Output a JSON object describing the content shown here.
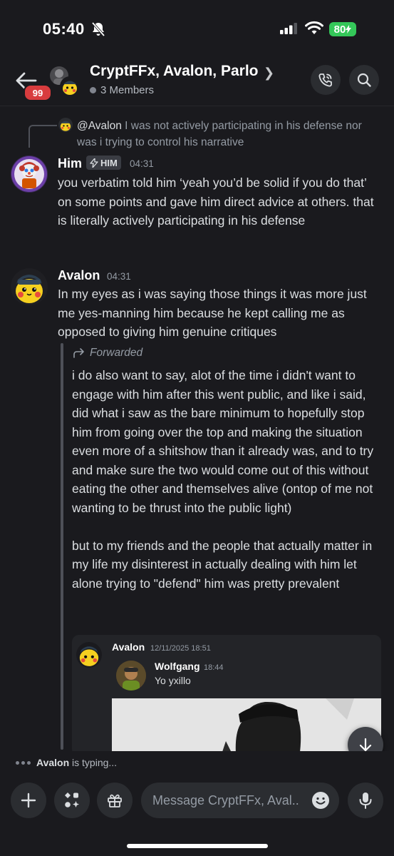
{
  "status_bar": {
    "time": "05:40",
    "battery": "80"
  },
  "header": {
    "unread_badge": "99",
    "title": "CryptFFx, Avalon, Parlo",
    "members": "3 Members",
    "icons": [
      "back-arrow-icon",
      "phone-call-icon",
      "search-icon"
    ]
  },
  "reply": {
    "mention": "@Avalon",
    "text": "I was not actively participating in his defense nor was i trying to control his narrative"
  },
  "messages": [
    {
      "author": "Him",
      "tag": "HIM",
      "time": "04:31",
      "text": "you verbatim told him ‘yeah you’d be solid if you do that’ on some points and gave him direct advice at others. that is literally actively participating in his defense"
    },
    {
      "author": "Avalon",
      "time": "04:31",
      "text": "In my eyes as i was saying those things it was more just me yes-manning him because he kept calling me as opposed to giving him genuine critiques",
      "forwarded": {
        "label": "Forwarded",
        "paragraphs": [
          "i do also want to say, alot of the time i didn't want to engage with him after this went public, and like i said, did what i saw as the bare minimum to hopefully stop him from going over the top and making the situation even more of a shitshow than it already was, and to try and make sure the two would come out of this without eating the other and themselves alive (ontop of me not wanting to be thrust into the public light)",
          "but to my friends and the people that actually matter in my life my disinterest in actually dealing with him let alone trying to \"defend\" him was pretty prevalent"
        ],
        "embed": {
          "author": "Avalon",
          "time": "12/11/2025 18:51",
          "inner_author": "Wolfgang",
          "inner_time": "18:44",
          "inner_text": "Yo yxillo"
        }
      }
    }
  ],
  "typing": {
    "user": "Avalon",
    "text": "is typing..."
  },
  "composer": {
    "placeholder": "Message CryptFFx, Aval..."
  }
}
